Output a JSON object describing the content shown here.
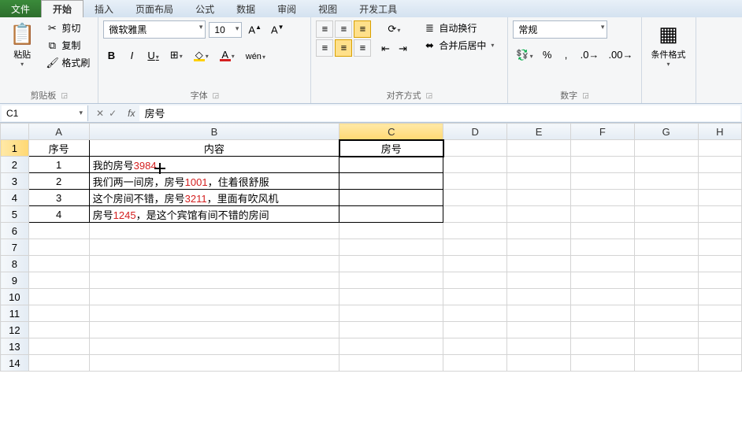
{
  "tabs": {
    "file": "文件",
    "home": "开始",
    "insert": "插入",
    "layout": "页面布局",
    "formulas": "公式",
    "data": "数据",
    "review": "审阅",
    "view": "视图",
    "dev": "开发工具"
  },
  "ribbon": {
    "clipboard": {
      "paste": "粘贴",
      "cut": "剪切",
      "copy": "复制",
      "brushFmt": "格式刷",
      "group": "剪贴板"
    },
    "font": {
      "name": "微软雅黑",
      "size": "10",
      "group": "字体"
    },
    "align": {
      "wrap": "自动换行",
      "merge": "合并后居中",
      "group": "对齐方式"
    },
    "number": {
      "format": "常规",
      "group": "数字"
    },
    "styles": {
      "condFmt": "条件格式"
    }
  },
  "formulaBar": {
    "cellRef": "C1",
    "value": "房号"
  },
  "columns": [
    "A",
    "B",
    "C",
    "D",
    "E",
    "F",
    "G",
    "H"
  ],
  "headersRow": {
    "A": "序号",
    "B": "内容",
    "C": "房号"
  },
  "rows": [
    {
      "n": "1",
      "pre": "我的房号",
      "num": "3984",
      "post": ""
    },
    {
      "n": "2",
      "pre": "我们两一间房，房号",
      "num": "1001",
      "post": "，住着很舒服"
    },
    {
      "n": "3",
      "pre": "这个房间不错，房号",
      "num": "3211",
      "post": "，里面有吹风机"
    },
    {
      "n": "4",
      "pre": "房号",
      "num": "1245",
      "post": "，是这个宾馆有间不错的房间"
    }
  ],
  "selected": {
    "col": "C",
    "row": 1
  }
}
